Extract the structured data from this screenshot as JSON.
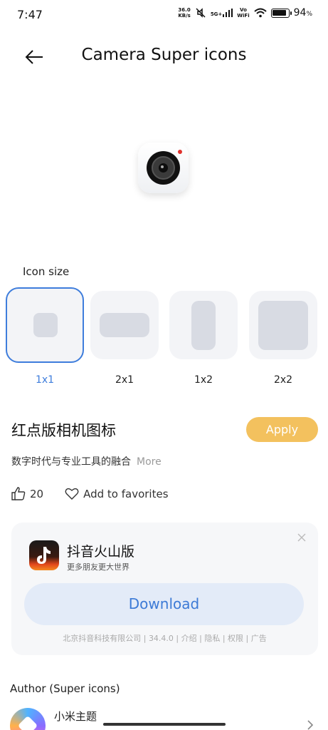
{
  "status_bar": {
    "time": "7:47",
    "net_speed_value": "36.0",
    "net_speed_unit": "KB/s",
    "network_type": "5G+",
    "volte": "Vo",
    "wifi_calling": "WiFi",
    "battery_percent": "94",
    "battery_percent_sign": "%",
    "battery_level": 0.94
  },
  "header": {
    "title": "Camera Super icons"
  },
  "icon_size": {
    "label": "Icon size",
    "options": [
      {
        "label": "1x1",
        "selected": true
      },
      {
        "label": "2x1",
        "selected": false
      },
      {
        "label": "1x2",
        "selected": false
      },
      {
        "label": "2x2",
        "selected": false
      }
    ]
  },
  "theme": {
    "name": "红点版相机图标",
    "apply_label": "Apply",
    "description": "数字时代与专业工具的融合",
    "more_label": "More",
    "like_count": "20",
    "favorite_label": "Add to favorites"
  },
  "ad": {
    "app_name": "抖音火山版",
    "slogan": "更多朋友更大世界",
    "download_label": "Download",
    "company": "北京抖音科技有限公司",
    "version": "34.4.0",
    "links": [
      "介绍",
      "隐私",
      "权限",
      "广告"
    ]
  },
  "author": {
    "section_title": "Author (Super icons)",
    "name": "小米主题"
  },
  "colors": {
    "accent_blue": "#3e7ddc",
    "apply_yellow": "#f3c15e",
    "download_bg": "#e3ebf8"
  }
}
